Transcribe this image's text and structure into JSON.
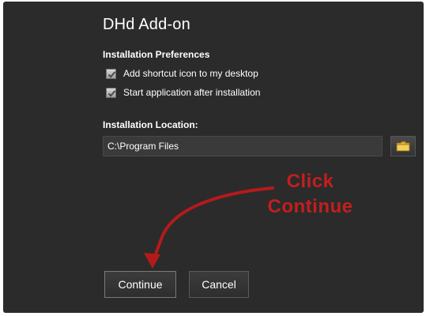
{
  "dialog": {
    "title": "DHd Add-on",
    "prefs_heading": "Installation Preferences",
    "options": [
      {
        "label": "Add shortcut icon to my desktop",
        "checked": true
      },
      {
        "label": "Start application after installation",
        "checked": true
      }
    ],
    "location_heading": "Installation Location:",
    "location_value": "C:\\Program Files",
    "browse_icon": "folder-icon",
    "continue_label": "Continue",
    "cancel_label": "Cancel"
  },
  "annotation": {
    "line1": "Click",
    "line2": "Continue",
    "color": "#c41e1e"
  }
}
